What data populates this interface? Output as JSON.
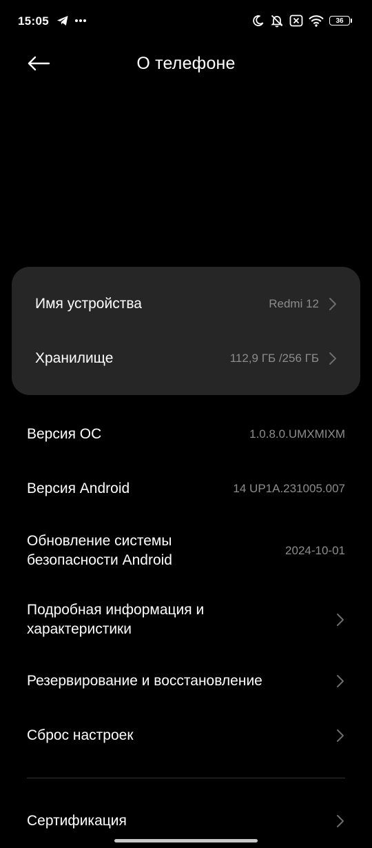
{
  "status_bar": {
    "time": "15:05",
    "left_icons": [
      "telegram-icon",
      "more-dots-icon"
    ],
    "right_icons": [
      "moon-icon",
      "bell-off-icon",
      "sim-off-icon",
      "wifi-icon"
    ],
    "battery_level": "36"
  },
  "header": {
    "title": "О телефоне",
    "back_icon": "arrow-left-icon"
  },
  "card": {
    "device_name": {
      "label": "Имя устройства",
      "value": "Redmi 12"
    },
    "storage": {
      "label": "Хранилище",
      "value": "112,9 ГБ /256 ГБ"
    }
  },
  "list": {
    "os_version": {
      "label": "Версия ОС",
      "value": "1.0.8.0.UMXMIXM"
    },
    "android_version": {
      "label": "Версия Android",
      "value": "14 UP1A.231005.007"
    },
    "security_update": {
      "label_line1": "Обновление системы",
      "label_line2": "безопасности Android",
      "value": "2024-10-01"
    },
    "details": {
      "label_line1": "Подробная информация и",
      "label_line2": "характеристики"
    },
    "backup": {
      "label": "Резервирование и восстановление"
    },
    "reset": {
      "label": "Сброс настроек"
    },
    "certification": {
      "label": "Сертификация"
    }
  },
  "colors": {
    "background": "#000000",
    "card": "#262626",
    "secondary_text": "#8c8c8c",
    "chevron": "#6e6e6e"
  }
}
